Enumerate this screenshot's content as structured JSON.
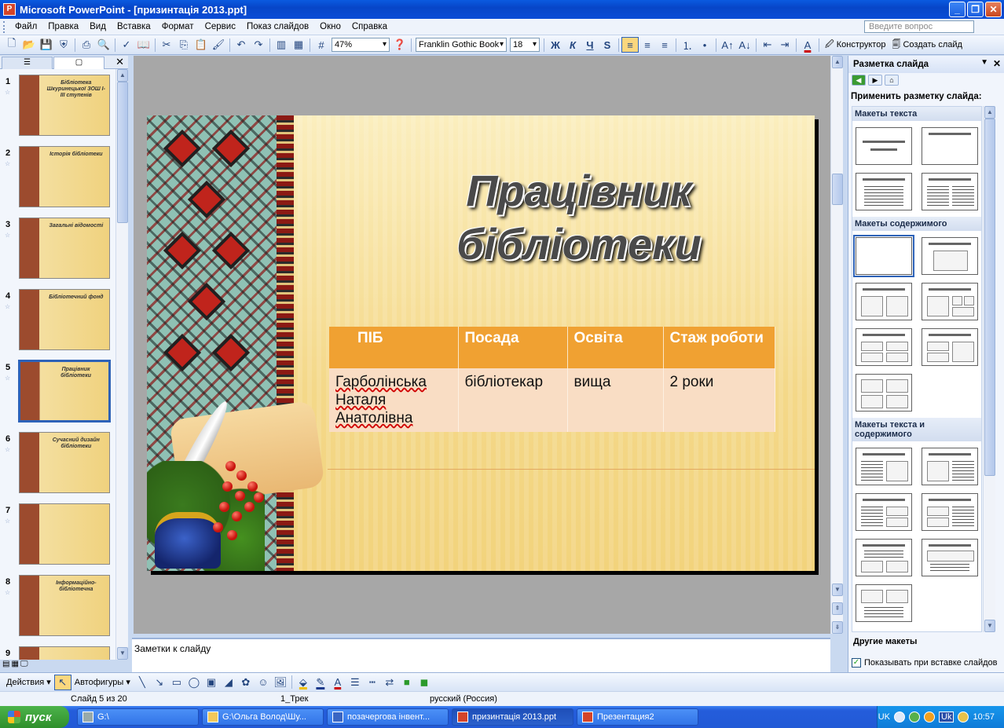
{
  "window": {
    "title": "Microsoft PowerPoint - [призинтація 2013.ppt]",
    "app_icon": "P"
  },
  "menu": {
    "items": [
      "Файл",
      "Правка",
      "Вид",
      "Вставка",
      "Формат",
      "Сервис",
      "Показ слайдов",
      "Окно",
      "Справка"
    ],
    "help_placeholder": "Введите вопрос"
  },
  "toolbar": {
    "zoom": "47%",
    "font": "Franklin Gothic Book",
    "font_size": "18",
    "bold": "Ж",
    "italic": "К",
    "underline": "Ч",
    "shadow": "S",
    "design_label": "Конструктор",
    "new_slide_label": "Создать слайд"
  },
  "thumbnails": [
    {
      "num": "1",
      "caption": "Бібліотека Шкуринецької ЗОШ І-ІІІ ступенів"
    },
    {
      "num": "2",
      "caption": "Історія бібліотеки"
    },
    {
      "num": "3",
      "caption": "Загальні відомості"
    },
    {
      "num": "4",
      "caption": "Бібліотечний фонд"
    },
    {
      "num": "5",
      "caption": "Працівник бібліотеки"
    },
    {
      "num": "6",
      "caption": "Сучасний дизайн бібліотеки"
    },
    {
      "num": "7",
      "caption": ""
    },
    {
      "num": "8",
      "caption": "Інформаційно-бібліотечна"
    },
    {
      "num": "9",
      "caption": ""
    }
  ],
  "slide": {
    "title_line1": "Працівник",
    "title_line2": "бібліотеки",
    "table": {
      "headers": [
        "ПІБ",
        "Посада",
        "Освіта",
        "Стаж роботи"
      ],
      "row": [
        "Гарболінська Наталя Анатолівна",
        "бібліотекар",
        "вища",
        "2  роки"
      ]
    }
  },
  "notes": {
    "placeholder": "Заметки к слайду"
  },
  "taskpane": {
    "title": "Разметка слайда",
    "apply_label": "Применить разметку слайда:",
    "sections": [
      "Макеты текста",
      "Макеты содержимого",
      "Макеты текста и содержимого"
    ],
    "other_label": "Другие макеты",
    "show_on_insert": "Показывать при вставке слайдов"
  },
  "drawbar": {
    "actions": "Действия",
    "autoshapes": "Автофигуры"
  },
  "status": {
    "slide": "Слайд 5 из 20",
    "design": "1_Трек",
    "language": "русский (Россия)"
  },
  "taskbar": {
    "start": "пуск",
    "tasks": [
      "G:\\",
      "G:\\Ольга Волод\\Шу...",
      "позачергова інвент...",
      "призинтація 2013.ppt",
      "Презентация2"
    ],
    "active_index": 3,
    "lang": "UK",
    "tray_lang": "Uk",
    "clock": "10:57"
  }
}
